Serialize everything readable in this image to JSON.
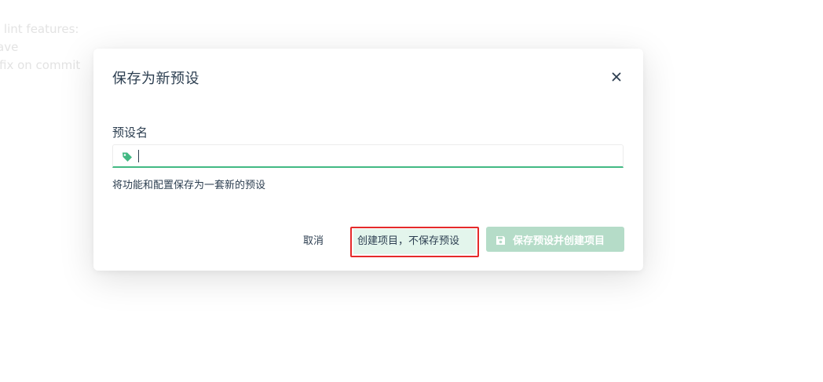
{
  "background": {
    "lines": [
      "l lint features:",
      "ave",
      "fix on commit"
    ]
  },
  "dialog": {
    "title": "保存为新预设",
    "close_label": "×",
    "field_label": "预设名",
    "input": {
      "value": "",
      "placeholder": "",
      "icon": "tag-icon"
    },
    "hint": "将功能和配置保存为一套新的预设",
    "buttons": {
      "cancel": "取消",
      "continue_without_saving": "创建项目，不保存预设",
      "save_and_create": "保存预设并创建项目",
      "save_icon": "save-icon"
    }
  },
  "colors": {
    "accent": "#42b983",
    "highlight_box": "#e52a2a",
    "disabled_primary": "#b5dcc8",
    "text": "#2c3e50"
  }
}
